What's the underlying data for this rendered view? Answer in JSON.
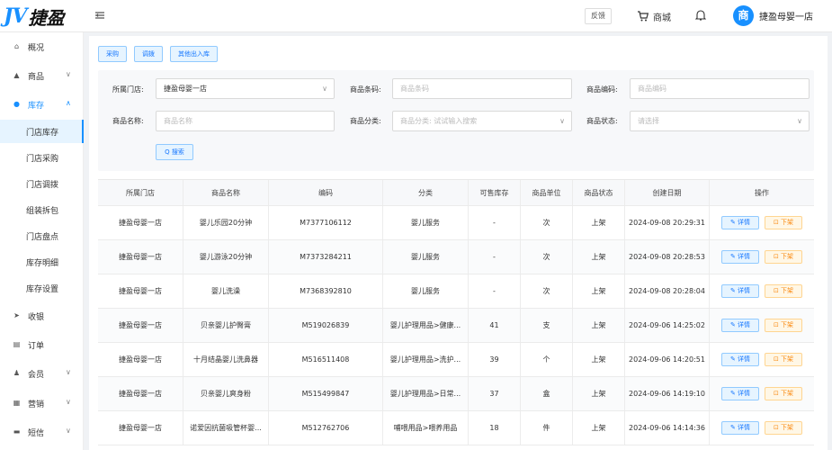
{
  "header": {
    "logo_mark": "JV",
    "logo_text": "捷盈",
    "feedback": "反馈",
    "mall": "商城",
    "avatar": "商",
    "user_name": "捷盈母婴一店"
  },
  "sidebar": {
    "items": [
      {
        "label": "概况",
        "icon": "home-icon",
        "glyph": "⌂"
      },
      {
        "label": "商品",
        "icon": "goods-icon",
        "glyph": "▲",
        "arrow": "∨"
      },
      {
        "label": "库存",
        "icon": "inventory-icon",
        "glyph": "●",
        "arrow": "∧"
      },
      {
        "label": "收银",
        "icon": "cashier-icon",
        "glyph": "➤"
      },
      {
        "label": "订单",
        "icon": "order-icon",
        "glyph": "▤"
      },
      {
        "label": "会员",
        "icon": "member-icon",
        "glyph": "♟",
        "arrow": "∨"
      },
      {
        "label": "营销",
        "icon": "marketing-icon",
        "glyph": "▦",
        "arrow": "∨"
      },
      {
        "label": "短信",
        "icon": "sms-icon",
        "glyph": "▬",
        "arrow": "∨"
      }
    ],
    "sub_items": [
      "门店库存",
      "门店采购",
      "门店调拨",
      "组装拆包",
      "门店盘点",
      "库存明细",
      "库存设置"
    ]
  },
  "tabs": [
    "采购",
    "调拨",
    "其他出入库"
  ],
  "filter": {
    "store_label": "所属门店:",
    "store_value": "捷盈母婴一店",
    "barcode_label": "商品条码:",
    "barcode_placeholder": "商品条码",
    "code_label": "商品编码:",
    "code_placeholder": "商品编码",
    "name_label": "商品名称:",
    "name_placeholder": "商品名称",
    "category_label": "商品分类:",
    "category_placeholder": "商品分类: 试试输入搜索",
    "status_label": "商品状态:",
    "status_placeholder": "请选择",
    "search": "Q 搜索"
  },
  "table": {
    "columns": [
      "所属门店",
      "商品名称",
      "编码",
      "分类",
      "可售库存",
      "商品单位",
      "商品状态",
      "创建日期",
      "操作"
    ],
    "detail_label": "✎ 详情",
    "down_label": "⊡ 下架",
    "rows": [
      [
        "捷盈母婴一店",
        "婴儿乐园20分钟",
        "M7377106112",
        "婴儿服务",
        "-",
        "次",
        "上架",
        "2024-09-08 20:29:31"
      ],
      [
        "捷盈母婴一店",
        "婴儿游泳20分钟",
        "M7373284211",
        "婴儿服务",
        "-",
        "次",
        "上架",
        "2024-09-08 20:28:53"
      ],
      [
        "捷盈母婴一店",
        "婴儿洗澡",
        "M7368392810",
        "婴儿服务",
        "-",
        "次",
        "上架",
        "2024-09-08 20:28:04"
      ],
      [
        "捷盈母婴一店",
        "贝亲婴儿护臀膏",
        "M519026839",
        "婴儿护理用品>健康...",
        "41",
        "支",
        "上架",
        "2024-09-06 14:25:02"
      ],
      [
        "捷盈母婴一店",
        "十月结晶婴儿洗鼻器",
        "M516511408",
        "婴儿护理用品>洗护...",
        "39",
        "个",
        "上架",
        "2024-09-06 14:20:51"
      ],
      [
        "捷盈母婴一店",
        "贝亲婴儿爽身粉",
        "M515499847",
        "婴儿护理用品>日常...",
        "37",
        "盒",
        "上架",
        "2024-09-06 14:19:10"
      ],
      [
        "捷盈母婴一店",
        "诺爱因抗菌吸管杯婴...",
        "M512762706",
        "哺喂用品>喂养用品",
        "18",
        "件",
        "上架",
        "2024-09-06 14:14:36"
      ]
    ]
  },
  "colors": {
    "accent": "#1890ff",
    "warning": "#fa8c16"
  }
}
